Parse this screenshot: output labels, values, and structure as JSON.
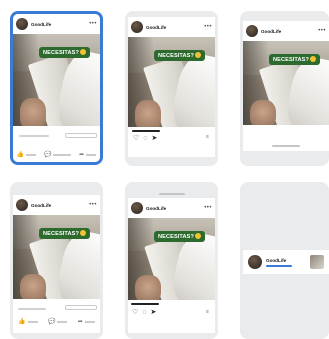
{
  "post": {
    "account": "GoodLife",
    "sticker_text": "NECESITAS?",
    "more_glyph": "•••"
  },
  "icons": {
    "like": "👍",
    "comment": "💬",
    "share": "➦",
    "heart": "♡",
    "reply": "◌",
    "send": "➤"
  },
  "colors": {
    "selection": "#3a7bd5",
    "sticker_bg": "#2d6a2d",
    "card_bg": "#eaebed"
  }
}
